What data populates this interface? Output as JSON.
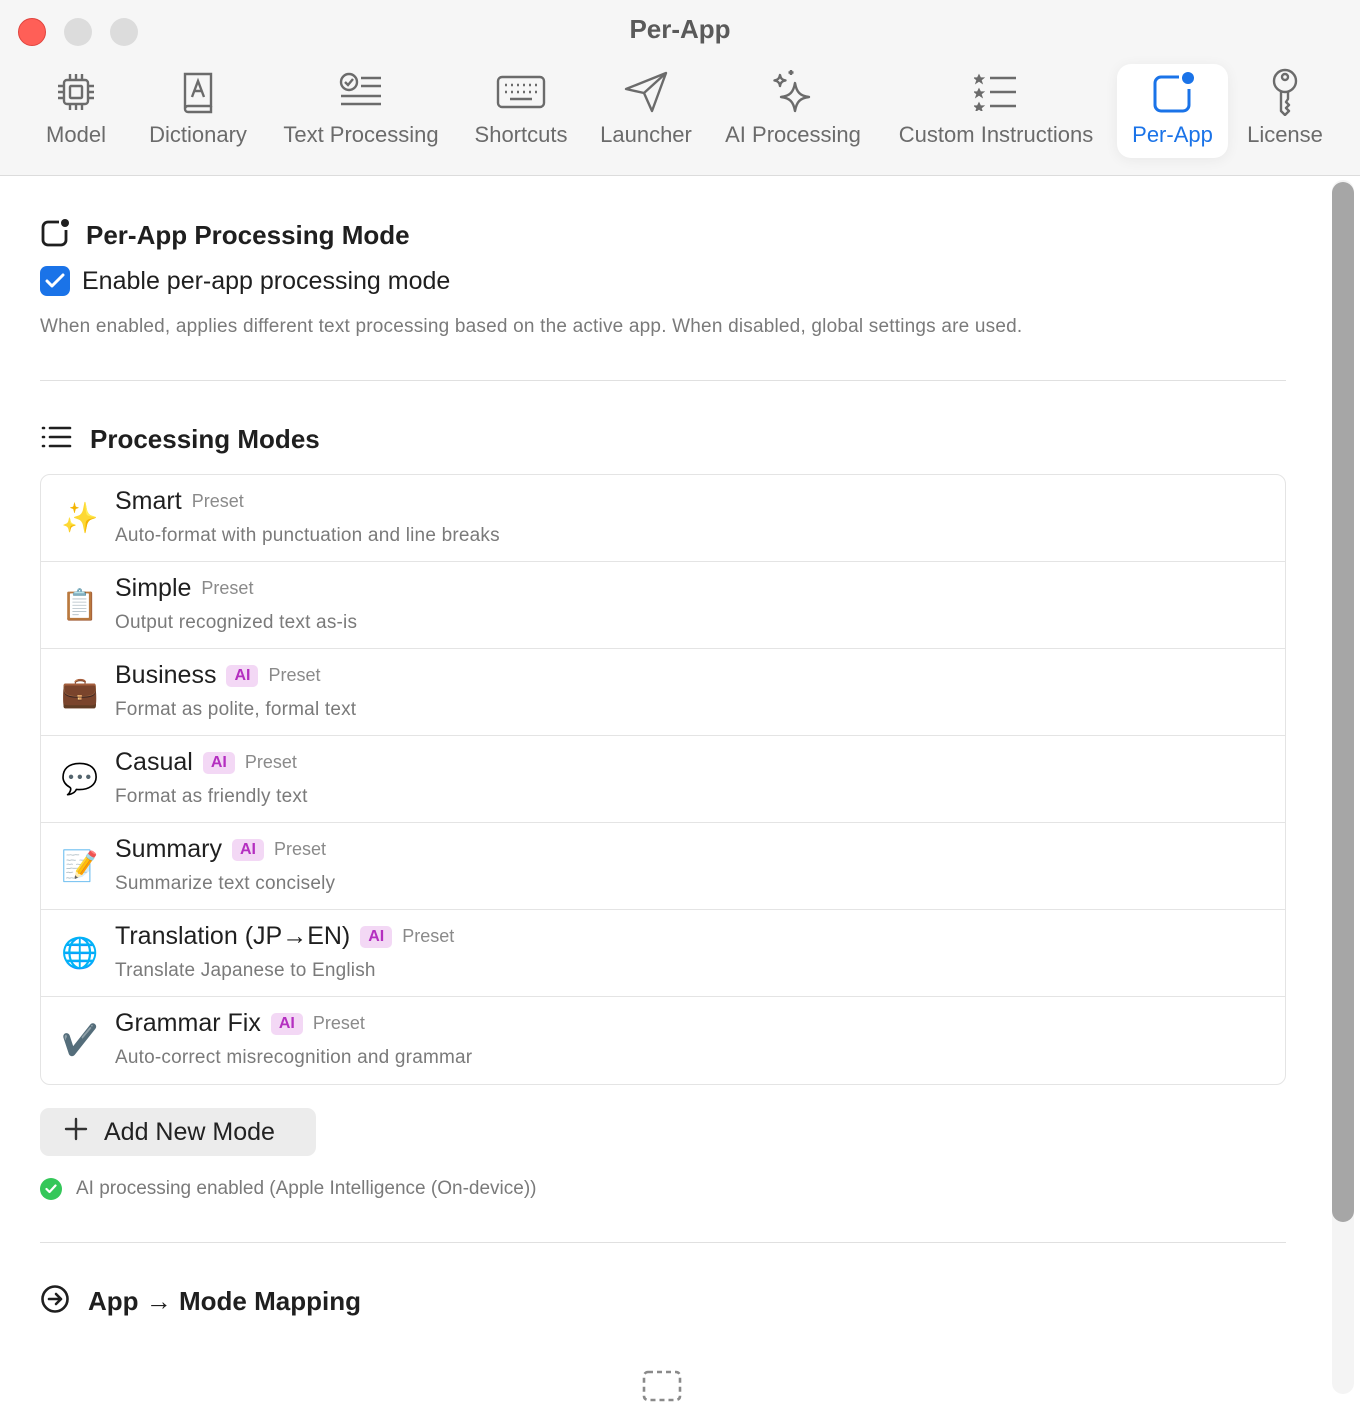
{
  "window": {
    "title": "Per-App"
  },
  "tabs": [
    {
      "label": "Model",
      "icon": "cpu-chip-icon"
    },
    {
      "label": "Dictionary",
      "icon": "dictionary-book-icon"
    },
    {
      "label": "Text Processing",
      "icon": "text-check-icon"
    },
    {
      "label": "Shortcuts",
      "icon": "keyboard-icon"
    },
    {
      "label": "Launcher",
      "icon": "paper-plane-icon"
    },
    {
      "label": "AI Processing",
      "icon": "sparkles-icon"
    },
    {
      "label": "Custom Instructions",
      "icon": "list-stars-icon"
    },
    {
      "label": "Per-App",
      "icon": "app-badge-icon",
      "active": true
    },
    {
      "label": "License",
      "icon": "key-icon"
    }
  ],
  "per_app": {
    "heading": "Per-App Processing Mode",
    "checkbox_label": "Enable per-app processing mode",
    "checkbox_checked": true,
    "help": "When enabled, applies different text processing based on the active app. When disabled, global settings are used."
  },
  "processing_modes": {
    "heading": "Processing Modes",
    "modes": [
      {
        "emoji": "✨",
        "name": "Smart",
        "ai": false,
        "preset": "Preset",
        "desc": "Auto-format with punctuation and line breaks"
      },
      {
        "emoji": "📋",
        "name": "Simple",
        "ai": false,
        "preset": "Preset",
        "desc": "Output recognized text as-is"
      },
      {
        "emoji": "💼",
        "name": "Business",
        "ai": true,
        "ai_label": "AI",
        "preset": "Preset",
        "desc": "Format as polite, formal text"
      },
      {
        "emoji": "💬",
        "name": "Casual",
        "ai": true,
        "ai_label": "AI",
        "preset": "Preset",
        "desc": "Format as friendly text"
      },
      {
        "emoji": "📝",
        "name": "Summary",
        "ai": true,
        "ai_label": "AI",
        "preset": "Preset",
        "desc": "Summarize text concisely"
      },
      {
        "emoji": "🌐",
        "name": "Translation (JP→EN)",
        "ai": true,
        "ai_label": "AI",
        "preset": "Preset",
        "desc": "Translate Japanese to English"
      },
      {
        "emoji": "✔️",
        "name": "Grammar Fix",
        "ai": true,
        "ai_label": "AI",
        "preset": "Preset",
        "desc": "Auto-correct misrecognition and grammar"
      }
    ],
    "add_button": "Add New Mode",
    "ai_status": "AI processing enabled (Apple Intelligence (On-device))"
  },
  "mapping": {
    "heading": "App → Mode Mapping"
  },
  "colors": {
    "accent": "#1a73e8",
    "ai_badge_bg": "#f3d8f5",
    "ai_badge_text": "#b42fc0",
    "status_green": "#34c759",
    "close_red": "#ff5f57"
  }
}
